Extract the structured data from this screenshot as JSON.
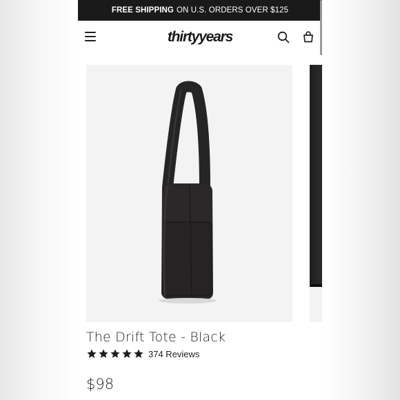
{
  "promo": {
    "strong": "FREE SHIPPING",
    "rest": "ON U.S. ORDERS OVER $125"
  },
  "header": {
    "logo": "thirtyyears",
    "icons": {
      "menu": "hamburger-menu-icon",
      "search": "search-icon",
      "cart": "shopping-bag-icon"
    }
  },
  "product": {
    "title": "The Drift Tote - Black",
    "rating": 5,
    "reviews": "374 Reviews",
    "price": "$98"
  },
  "colors": {
    "promo_bg": "#1a1a1a",
    "text": "#222222",
    "image_bg": "#f3f3f3",
    "bag": "#2a2828"
  }
}
